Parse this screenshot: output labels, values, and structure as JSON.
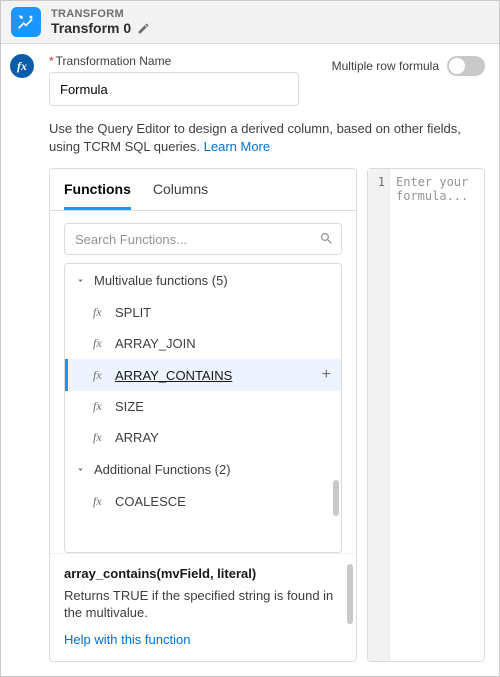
{
  "header": {
    "eyebrow": "TRANSFORM",
    "title": "Transform 0"
  },
  "form": {
    "name_label": "Transformation Name",
    "name_value": "Formula",
    "toggle_label": "Multiple row formula"
  },
  "helptext": {
    "line": "Use the Query Editor to design a derived column, based on other fields, using TCRM SQL queries. ",
    "learn_more": "Learn More"
  },
  "tabs": {
    "functions": "Functions",
    "columns": "Columns"
  },
  "search": {
    "placeholder": "Search Functions..."
  },
  "groups": {
    "multivalue": {
      "label": "Multivalue functions (5)",
      "items": [
        "SPLIT",
        "ARRAY_JOIN",
        "ARRAY_CONTAINS",
        "SIZE",
        "ARRAY"
      ]
    },
    "additional": {
      "label": "Additional Functions (2)",
      "items": [
        "COALESCE"
      ]
    }
  },
  "detail": {
    "signature": "array_contains(mvField, literal)",
    "description": "Returns TRUE if the specified string is found in the multivalue.",
    "help_link": "Help with this function"
  },
  "editor": {
    "line_number": "1",
    "placeholder": "Enter your formula..."
  }
}
